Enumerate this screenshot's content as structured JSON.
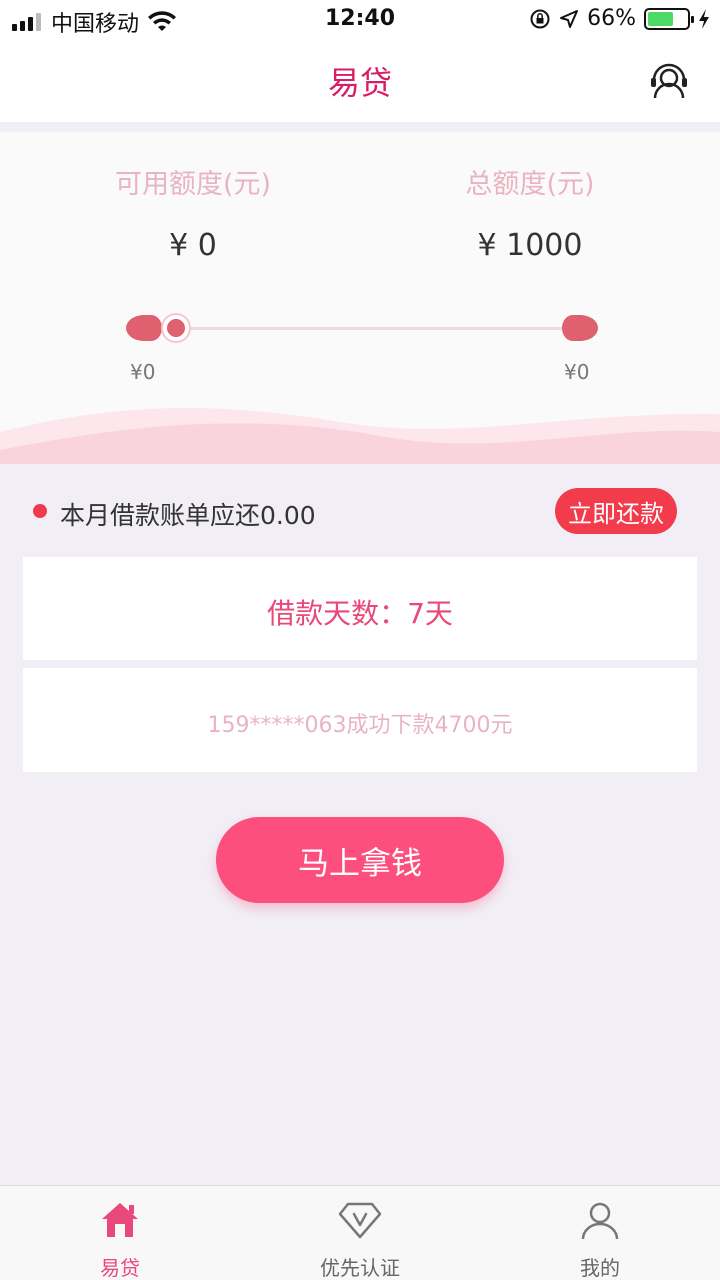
{
  "status_bar": {
    "carrier": "中国移动",
    "time": "12:40",
    "battery_percent": "66%",
    "battery_level": 0.66,
    "icons": [
      "signal-icon",
      "wifi-icon",
      "orientation-lock-icon",
      "location-icon",
      "charging-icon"
    ]
  },
  "nav": {
    "title": "易贷",
    "right_icon": "customer-service-icon"
  },
  "quota": {
    "available_label": "可用额度(元)",
    "available_value": "¥ 0",
    "total_label": "总额度(元)",
    "total_value": "¥ 1000",
    "slider_min": "¥0",
    "slider_max": "¥0",
    "slider_level": 0
  },
  "bill": {
    "text": "本月借款账单应还0.00",
    "repay_label": "立即还款"
  },
  "loan_days": {
    "text": "借款天数：7天"
  },
  "notice": {
    "text": "159*****063成功下款4700元"
  },
  "cta": {
    "label": "马上拿钱"
  },
  "tab_bar": {
    "items": [
      {
        "label": "易贷",
        "icon": "home-icon",
        "active": true
      },
      {
        "label": "优先认证",
        "icon": "diamond-v-icon",
        "active": false
      },
      {
        "label": "我的",
        "icon": "user-icon",
        "active": false
      }
    ]
  },
  "colors": {
    "brand": "#d81e63",
    "accent_pink": "#fd4f7d",
    "repay_red": "#f23b4b",
    "background": "#f1eef5"
  }
}
